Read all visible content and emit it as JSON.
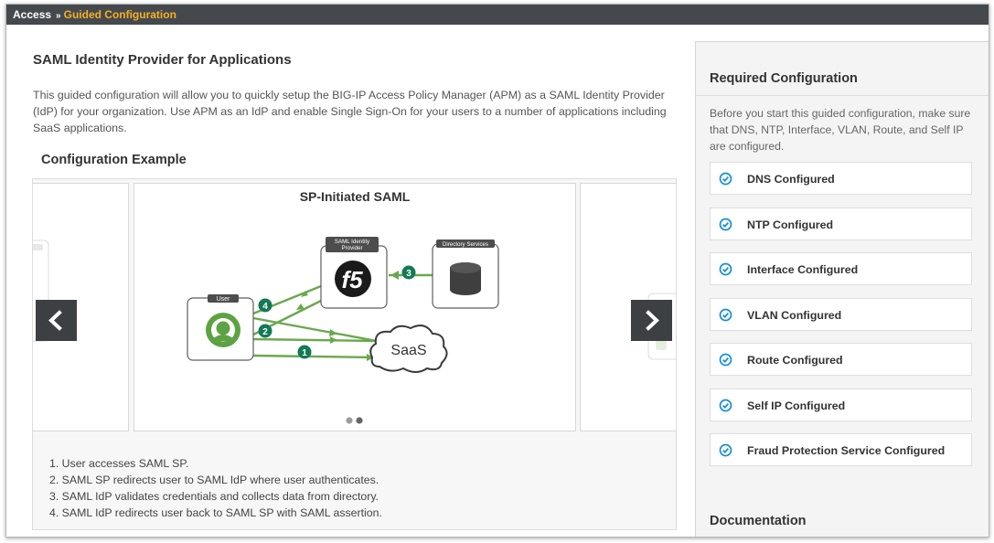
{
  "breadcrumb": {
    "root": "Access",
    "separator": "»",
    "current": "Guided Configuration"
  },
  "page": {
    "title": "SAML Identity Provider for Applications",
    "intro": "This guided configuration will allow you to quickly setup the BIG-IP Access Policy Manager (APM) as a SAML Identity Provider (IdP) for your organization. Use APM as an IdP and enable Single Sign-On for your users to a number of applications including SaaS applications."
  },
  "example": {
    "section_title": "Configuration Example",
    "slide_title": "SP-Initiated SAML",
    "diagram": {
      "user_label": "User",
      "idp_label_line1": "SAML Identity",
      "idp_label_line2": "Provider",
      "dir_label": "Directory Services",
      "saas_label": "SaaS",
      "idp_logo": "f5",
      "badges": [
        "1",
        "2",
        "3",
        "4"
      ]
    },
    "steps": [
      "1. User accesses SAML SP.",
      "2. SAML SP redirects user to SAML IdP where user authenticates.",
      "3. SAML IdP validates credentials and collects data from directory.",
      "4. SAML IdP redirects user back to SAML SP with SAML assertion."
    ],
    "icons": {
      "prev": "chevron-left-icon",
      "next": "chevron-right-icon",
      "check": "circle-check-icon"
    }
  },
  "sidebar": {
    "title": "Required Configuration",
    "description": "Before you start this guided configuration, make sure that DNS, NTP, Interface, VLAN, Route, and Self IP are configured.",
    "checks": [
      {
        "label": "DNS Configured"
      },
      {
        "label": "NTP Configured"
      },
      {
        "label": "Interface Configured"
      },
      {
        "label": "VLAN Configured"
      },
      {
        "label": "Route Configured"
      },
      {
        "label": "Self IP Configured"
      },
      {
        "label": "Fraud Protection Service Configured"
      }
    ],
    "documentation_title": "Documentation"
  },
  "colors": {
    "topbar": "#45494e",
    "breadcrumb_accent": "#f5b021",
    "check_blue": "#1a8fd6",
    "diagram_green": "#6aa84f",
    "badge_green": "#137a55"
  }
}
